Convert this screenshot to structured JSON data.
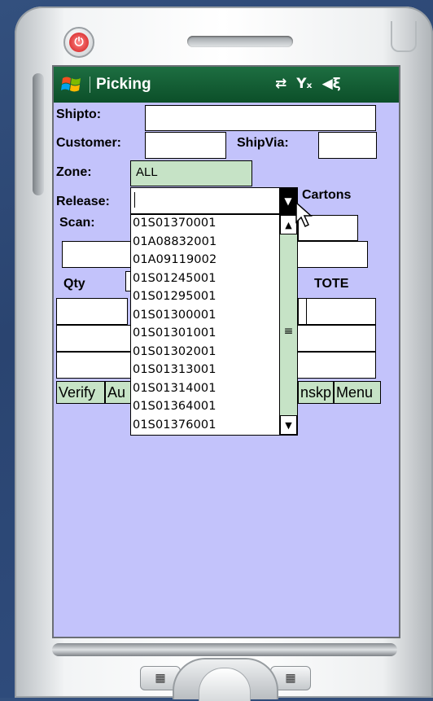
{
  "device": {
    "power_icon": "power-icon",
    "start_icon": "windows-flag-icon"
  },
  "titlebar": {
    "title": "Picking",
    "icons": [
      "connectivity-arrows-icon",
      "signal-off-icon",
      "speaker-icon"
    ]
  },
  "form": {
    "shipto_label": "Shipto:",
    "customer_label": "Customer:",
    "shipvia_label": "ShipVia:",
    "zone_label": "Zone:",
    "zone_value": "ALL",
    "release_label": "Release:",
    "release_value": "",
    "cartons_label": "Cartons",
    "scan_label": "Scan:",
    "qty_label": "Qty",
    "tote_label": "TOTE"
  },
  "dropdown": {
    "items": [
      "01S01370001",
      "01A08832001",
      "01A09119002",
      "01S01245001",
      "01S01295001",
      "01S01300001",
      "01S01301001",
      "01S01302001",
      "01S01313001",
      "01S01314001",
      "01S01364001",
      "01S01376001"
    ]
  },
  "buttons": {
    "verify": "Verify",
    "auto": "Au",
    "skip": "nskp",
    "menu": "Menu"
  }
}
